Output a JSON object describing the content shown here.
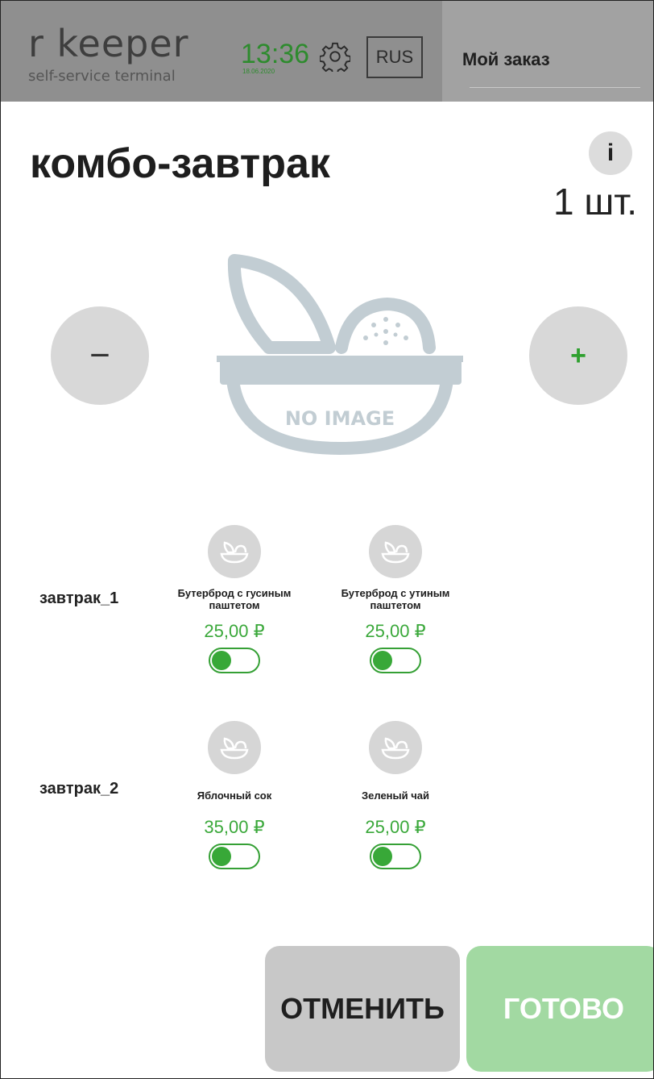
{
  "header": {
    "logo": "r keeper",
    "logo_sub": "self-service terminal",
    "time": "13:36",
    "date": "18.06.2020",
    "language": "RUS",
    "order_title": "Мой заказ"
  },
  "product": {
    "title": "комбо-завтрак",
    "info_label": "i",
    "quantity": "1 шт.",
    "minus_label": "−",
    "plus_label": "+",
    "no_image_text": "NO IMAGE"
  },
  "groups": [
    {
      "label": "завтрак_1",
      "items": [
        {
          "name": "Бутерброд с гусиным паштетом",
          "price": "25,00 ₽",
          "selected": true
        },
        {
          "name": "Бутерброд с утиным паштетом",
          "price": "25,00 ₽",
          "selected": true
        }
      ]
    },
    {
      "label": "завтрак_2",
      "items": [
        {
          "name": "Яблочный сок",
          "price": "35,00 ₽",
          "selected": true
        },
        {
          "name": "Зеленый чай",
          "price": "25,00 ₽",
          "selected": true
        }
      ]
    }
  ],
  "actions": {
    "cancel_label": "ОТМЕНИТЬ",
    "done_label": "ГОТОВО"
  },
  "colors": {
    "accent_green": "#38a838",
    "header_bg": "#8f8f8f",
    "done_bg": "#a2d9a2"
  }
}
